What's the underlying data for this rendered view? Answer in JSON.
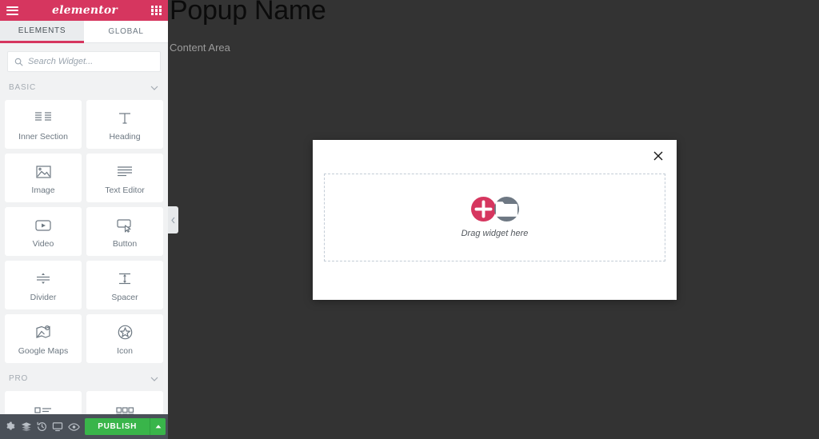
{
  "colors": {
    "brand_pink": "#d6365f",
    "publish_green": "#39b54a",
    "canvas_dark": "#333333",
    "panel_bg": "#f1f2f3",
    "footer_bg": "#4a5058"
  },
  "canvas": {
    "title": "Popup Name",
    "subtitle": "Content Area"
  },
  "popup": {
    "close_label": "×",
    "dropzone_label": "Drag widget here",
    "add_button_label": "+",
    "folder_button_label": "Template Library"
  },
  "sidebar": {
    "header": {
      "menu_label": "Menu",
      "brand": "elementor",
      "apps_label": "Apps"
    },
    "tabs": [
      {
        "label": "ELEMENTS",
        "active": true
      },
      {
        "label": "GLOBAL",
        "active": false
      }
    ],
    "search": {
      "placeholder": "Search Widget...",
      "value": ""
    },
    "categories": [
      {
        "title": "BASIC",
        "expanded": true,
        "widgets": [
          {
            "name": "Inner Section",
            "icon": "inner-section-icon"
          },
          {
            "name": "Heading",
            "icon": "heading-icon"
          },
          {
            "name": "Image",
            "icon": "image-icon"
          },
          {
            "name": "Text Editor",
            "icon": "text-editor-icon"
          },
          {
            "name": "Video",
            "icon": "video-icon"
          },
          {
            "name": "Button",
            "icon": "button-icon"
          },
          {
            "name": "Divider",
            "icon": "divider-icon"
          },
          {
            "name": "Spacer",
            "icon": "spacer-icon"
          },
          {
            "name": "Google Maps",
            "icon": "google-maps-icon"
          },
          {
            "name": "Icon",
            "icon": "icon-star-icon"
          }
        ]
      },
      {
        "title": "PRO",
        "expanded": true,
        "widgets": [
          {
            "name": "",
            "icon": "posts-icon"
          },
          {
            "name": "",
            "icon": "portfolio-icon"
          }
        ]
      }
    ],
    "collapse_label": "Collapse panel",
    "footer": {
      "icons": [
        {
          "name": "settings-icon",
          "label": "Settings"
        },
        {
          "name": "navigator-icon",
          "label": "Navigator"
        },
        {
          "name": "history-icon",
          "label": "History"
        },
        {
          "name": "responsive-icon",
          "label": "Responsive Mode"
        },
        {
          "name": "preview-icon",
          "label": "Preview Changes"
        }
      ],
      "publish_label": "PUBLISH",
      "publish_caret_label": "Publish options"
    }
  }
}
